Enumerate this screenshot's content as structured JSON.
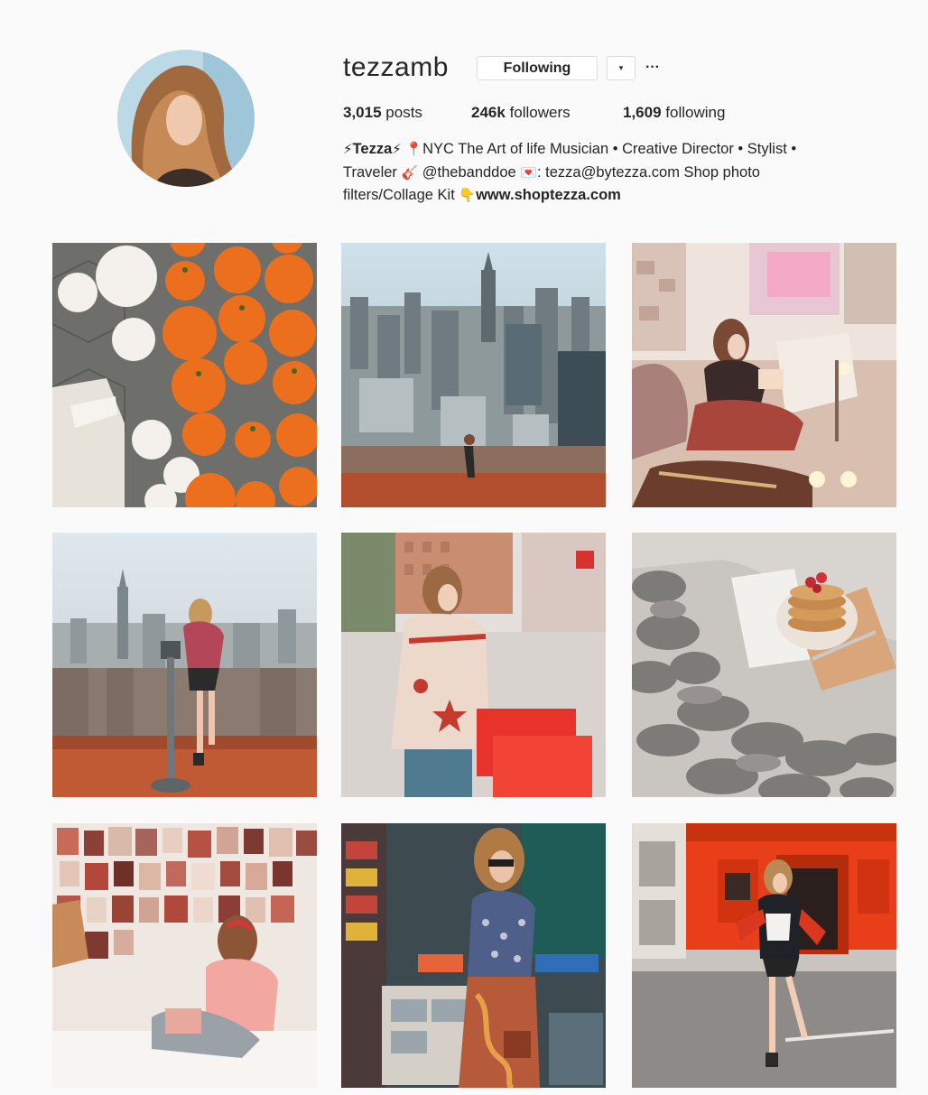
{
  "profile": {
    "username": "tezzamb",
    "following_button": "Following",
    "dropdown_glyph": "▾",
    "more_glyph": "···",
    "stats": {
      "posts_count": "3,015",
      "posts_label": "posts",
      "followers_count": "246k",
      "followers_label": "followers",
      "following_count": "1,609",
      "following_label": "following"
    },
    "bio": {
      "name": "Tezza",
      "line1_rest": "NYC The Art of life Musician • Creative Director • Stylist •",
      "line2_a": "Traveler",
      "line2_handle": "@thebanddoe",
      "line2_b": ": tezza@bytezza.com Shop photo",
      "line3_a": "filters/Collage Kit",
      "line3_link": "www.shoptezza.com"
    }
  },
  "icons": {
    "bolt": "⚡",
    "pin": "📍",
    "guitar": "🎸",
    "heart_letter": "💌",
    "point_down": "👇"
  },
  "posts": [
    {
      "subject": "pumpkins",
      "accent": "#e8722a"
    },
    {
      "subject": "city-skyline",
      "accent": "#8c9aa3"
    },
    {
      "subject": "cozy-bedroom",
      "accent": "#c1443b"
    },
    {
      "subject": "observation-deck",
      "accent": "#9a7a6a"
    },
    {
      "subject": "street-jacket",
      "accent": "#e3302b"
    },
    {
      "subject": "pancakes-blanket",
      "accent": "#8b8b8b"
    },
    {
      "subject": "photo-wall",
      "accent": "#e9a39a"
    },
    {
      "subject": "newsstand",
      "accent": "#4a6a78"
    },
    {
      "subject": "red-storefront",
      "accent": "#e8461f"
    }
  ]
}
